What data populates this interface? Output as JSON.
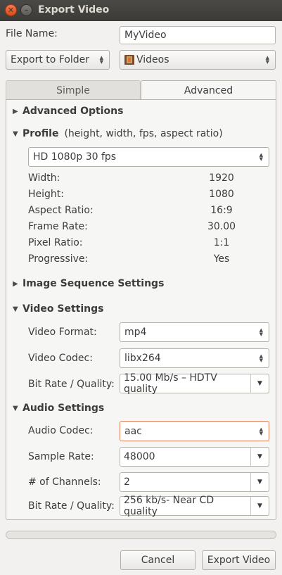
{
  "window": {
    "title": "Export Video"
  },
  "file_name": {
    "label": "File Name:",
    "value": "MyVideo"
  },
  "export_mode": {
    "value": "Export to Folder"
  },
  "folder": {
    "value": "Videos",
    "icon": "folder-video-icon"
  },
  "tabs": [
    {
      "label": "Simple",
      "active": false
    },
    {
      "label": "Advanced",
      "active": true
    }
  ],
  "advanced_options": {
    "label": "Advanced Options",
    "expanded": false
  },
  "profile": {
    "label": "Profile",
    "hint": "(height, width, fps, aspect ratio)",
    "expanded": true,
    "selected": "HD 1080p 30 fps",
    "rows": [
      {
        "label": "Width:",
        "value": "1920"
      },
      {
        "label": "Height:",
        "value": "1080"
      },
      {
        "label": "Aspect Ratio:",
        "value": "16:9"
      },
      {
        "label": "Frame Rate:",
        "value": "30.00"
      },
      {
        "label": "Pixel Ratio:",
        "value": "1:1"
      },
      {
        "label": "Progressive:",
        "value": "Yes"
      }
    ]
  },
  "image_sequence": {
    "label": "Image Sequence Settings",
    "expanded": false
  },
  "video": {
    "label": "Video Settings",
    "expanded": true,
    "format": {
      "label": "Video Format:",
      "value": "mp4"
    },
    "codec": {
      "label": "Video Codec:",
      "value": "libx264"
    },
    "bitrate": {
      "label": "Bit Rate / Quality:",
      "value": "15.00 Mb/s – HDTV quality"
    }
  },
  "audio": {
    "label": "Audio Settings",
    "expanded": true,
    "codec": {
      "label": "Audio Codec:",
      "value": "aac"
    },
    "sample_rate": {
      "label": "Sample Rate:",
      "value": "48000"
    },
    "channels": {
      "label": "# of Channels:",
      "value": "2"
    },
    "bitrate": {
      "label": "Bit Rate / Quality:",
      "value": "256 kb/s- Near CD quality"
    }
  },
  "progress": {
    "fraction": 0.0
  },
  "buttons": {
    "cancel": "Cancel",
    "export": "Export Video"
  },
  "colors": {
    "accent": "#f07746",
    "titlebar": "#3c3b37",
    "background": "#f2f1f0"
  }
}
